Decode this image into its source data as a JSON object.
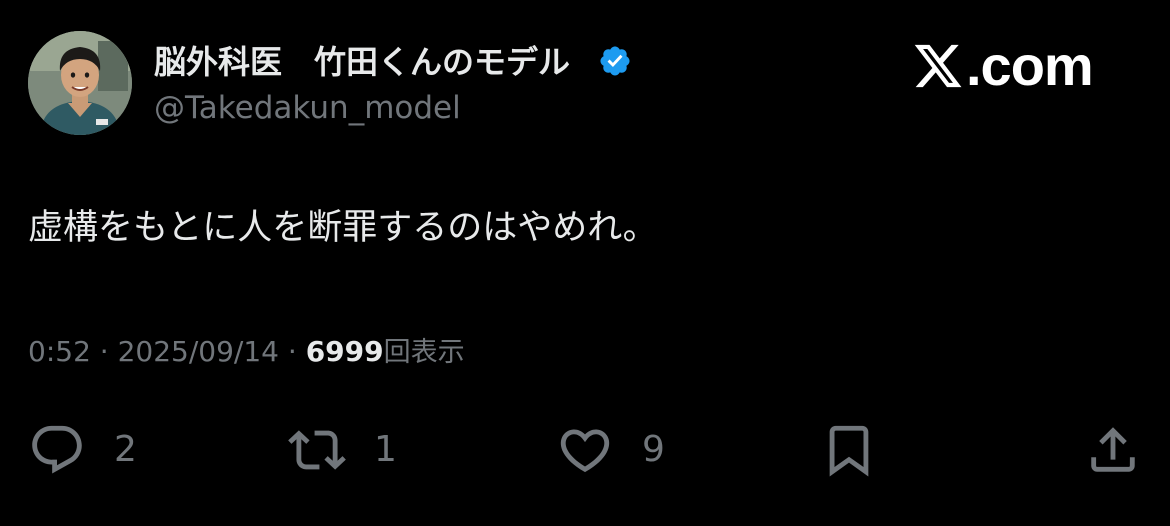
{
  "watermark": {
    "logo_icon": "x-logo-icon",
    "domain": ".com"
  },
  "author": {
    "display_name": "脳外科医　竹田くんのモデル",
    "handle": "@Takedakun_model",
    "verified_icon": "verified-badge-icon",
    "verified_color": "#1d9bf0"
  },
  "tweet": {
    "text": "虚構をもとに人を断罪するのはやめれ。"
  },
  "meta": {
    "time": "0:52",
    "separator": " · ",
    "date": "2025/09/14",
    "views_count": "6999",
    "views_label": "回表示"
  },
  "actions": {
    "reply": {
      "icon": "reply-icon",
      "count": "2"
    },
    "retweet": {
      "icon": "retweet-icon",
      "count": "1"
    },
    "like": {
      "icon": "heart-icon",
      "count": "9"
    },
    "bookmark": {
      "icon": "bookmark-icon"
    },
    "share": {
      "icon": "share-icon"
    }
  },
  "colors": {
    "background": "#000000",
    "primary_text": "#e7e9ea",
    "secondary_text": "#71767b",
    "verified": "#1d9bf0"
  }
}
